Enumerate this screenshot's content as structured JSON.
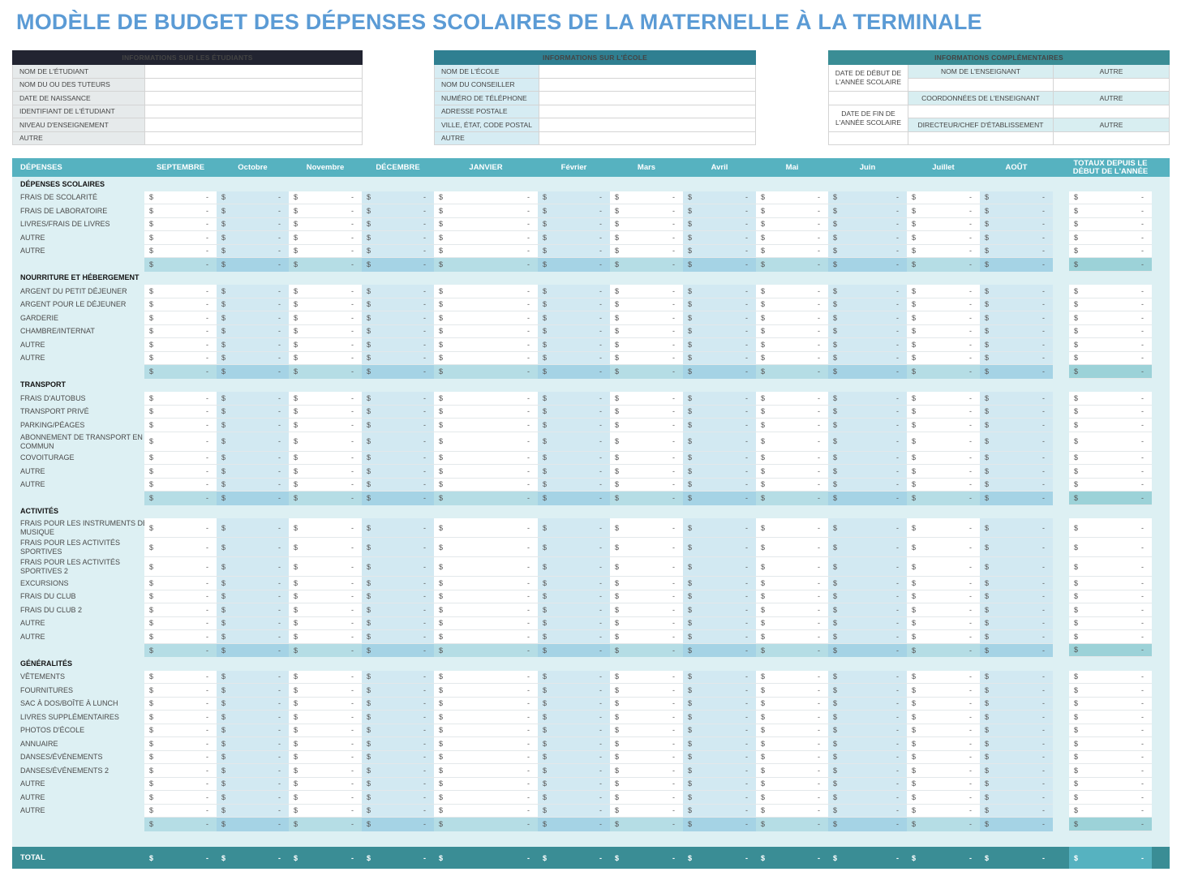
{
  "title": "MODÈLE DE BUDGET DES DÉPENSES SCOLAIRES DE LA MATERNELLE À LA TERMINALE",
  "student_info": {
    "header": "INFORMATIONS SUR LES ÉTUDIANTS",
    "fields": [
      {
        "label": "NOM DE L'ÉTUDIANT",
        "value": ""
      },
      {
        "label": "NOM DU OU DES TUTEURS",
        "value": ""
      },
      {
        "label": "DATE DE NAISSANCE",
        "value": ""
      },
      {
        "label": "IDENTIFIANT DE L'ÉTUDIANT",
        "value": ""
      },
      {
        "label": "NIVEAU D'ENSEIGNEMENT",
        "value": ""
      },
      {
        "label": "AUTRE",
        "value": ""
      }
    ]
  },
  "school_info": {
    "header": "INFORMATIONS SUR L'ÉCOLE",
    "fields": [
      {
        "label": "NOM DE L'ÉCOLE",
        "value": ""
      },
      {
        "label": "NOM DU CONSEILLER",
        "value": ""
      },
      {
        "label": "NUMÉRO DE TÉLÉPHONE",
        "value": ""
      },
      {
        "label": "ADRESSE POSTALE",
        "value": ""
      },
      {
        "label": "VILLE, ÉTAT, CODE POSTAL",
        "value": ""
      },
      {
        "label": "AUTRE",
        "value": ""
      }
    ]
  },
  "extra_info": {
    "header": "INFORMATIONS COMPLÉMENTAIRES",
    "start_date_label": "DATE DE DÉBUT DE L'ANNÉE SCOLAIRE",
    "end_date_label": "DATE DE FIN DE L'ANNÉE SCOLAIRE",
    "teacher_name_label": "NOM DE L'ENSEIGNANT",
    "teacher_contact_label": "COORDONNÉES DE L'ENSEIGNANT",
    "principal_label": "DIRECTEUR/CHEF D'ÉTABLISSEMENT",
    "other_label": "AUTRE"
  },
  "budget": {
    "first_header": "DÉPENSES",
    "months": [
      "SEPTEMBRE",
      "Octobre",
      "Novembre",
      "DÉCEMBRE",
      "JANVIER",
      "Février",
      "Mars",
      "Avril",
      "Mai",
      "Juin",
      "Juillet",
      "AOÛT"
    ],
    "totals_header": "TOTAUX DEPUIS LE DÉBUT DE L'ANNÉE",
    "currency": "$",
    "empty_value": "-",
    "sections": [
      {
        "name": "DÉPENSES SCOLAIRES",
        "items": [
          "FRAIS DE SCOLARITÉ",
          "FRAIS DE LABORATOIRE",
          "LIVRES/FRAIS DE LIVRES",
          "AUTRE",
          "AUTRE"
        ]
      },
      {
        "name": "NOURRITURE ET HÉBERGEMENT",
        "items": [
          "ARGENT DU PETIT DÉJEUNER",
          "ARGENT POUR LE DÉJEUNER",
          "GARDERIE",
          "CHAMBRE/INTERNAT",
          "AUTRE",
          "AUTRE"
        ]
      },
      {
        "name": "TRANSPORT",
        "items": [
          "FRAIS D'AUTOBUS",
          "TRANSPORT PRIVÉ",
          "PARKING/PÉAGES",
          "ABONNEMENT DE TRANSPORT EN COMMUN",
          "COVOITURAGE",
          "AUTRE",
          "AUTRE"
        ]
      },
      {
        "name": "ACTIVITÉS",
        "items": [
          "FRAIS POUR LES INSTRUMENTS DE MUSIQUE",
          "FRAIS POUR LES ACTIVITÉS SPORTIVES",
          "FRAIS POUR LES ACTIVITÉS SPORTIVES 2",
          "EXCURSIONS",
          "FRAIS DU CLUB",
          "FRAIS DU CLUB 2",
          "AUTRE",
          "AUTRE"
        ]
      },
      {
        "name": "GÉNÉRALITÉS",
        "items": [
          "VÊTEMENTS",
          "FOURNITURES",
          "SAC À DOS/BOÎTE À LUNCH",
          "LIVRES SUPPLÉMENTAIRES",
          "PHOTOS D'ÉCOLE",
          "ANNUAIRE",
          "DANSES/ÉVÉNEMENTS",
          "DANSES/ÉVÉNEMENTS 2",
          "AUTRE",
          "AUTRE",
          "AUTRE"
        ]
      }
    ],
    "total_label": "TOTAL"
  },
  "colors": {
    "title": "#5b9bd5",
    "student_header": "#222431",
    "school_header": "#2f7f91",
    "extra_header": "#3a8d95",
    "budget_header": "#56b2c0",
    "total_bar": "#3a8d95"
  }
}
